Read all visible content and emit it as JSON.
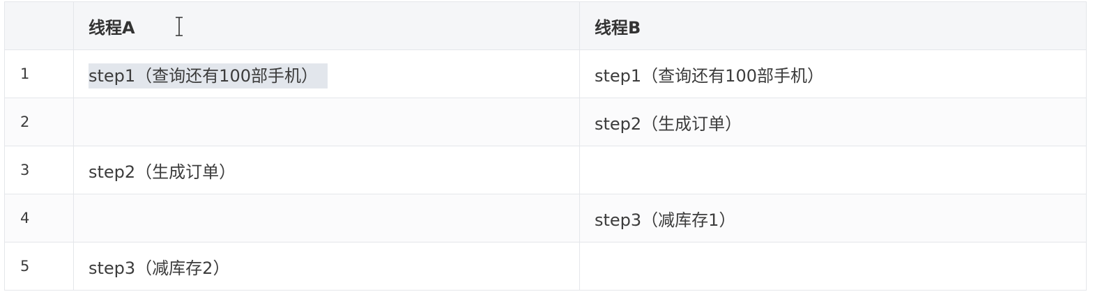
{
  "table": {
    "header": {
      "index_label": "",
      "col_a": "线程A",
      "col_b": "线程B"
    },
    "rows": [
      {
        "index": "1",
        "a": "step1（查询还有100部手机）",
        "b": "step1（查询还有100部手机）"
      },
      {
        "index": "2",
        "a": "",
        "b": "step2（生成订单）"
      },
      {
        "index": "3",
        "a": "step2（生成订单）",
        "b": ""
      },
      {
        "index": "4",
        "a": "",
        "b": "step3（减库存1）"
      },
      {
        "index": "5",
        "a": "step3（减库存2）",
        "b": ""
      }
    ]
  },
  "colors": {
    "header_bg": "#f5f6f8",
    "border": "#e4e6ea",
    "selection_bg": "#e2e6ec",
    "text": "#3c3c3c"
  },
  "icons": {
    "cursor": "text-cursor-icon"
  }
}
